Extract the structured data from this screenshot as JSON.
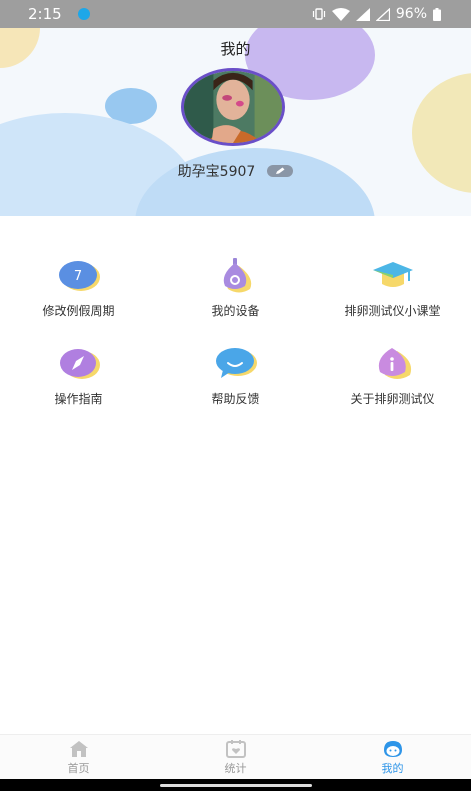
{
  "status_bar": {
    "time": "2:15",
    "battery": "96%"
  },
  "header": {
    "title": "我的",
    "username": "助孕宝5907"
  },
  "menu": [
    {
      "label": "修改例假周期",
      "icon": "calendar-7-icon"
    },
    {
      "label": "我的设备",
      "icon": "device-icon"
    },
    {
      "label": "排卵测试仪小课堂",
      "icon": "graduation-cap-icon"
    },
    {
      "label": "操作指南",
      "icon": "compass-icon"
    },
    {
      "label": "帮助反馈",
      "icon": "chat-bubble-icon"
    },
    {
      "label": "关于排卵测试仪",
      "icon": "info-icon"
    }
  ],
  "icon_glyphs": {
    "calendar": "7"
  },
  "bottom_nav": [
    {
      "label": "首页",
      "icon": "home-icon",
      "active": false
    },
    {
      "label": "统计",
      "icon": "stats-icon",
      "active": false
    },
    {
      "label": "我的",
      "icon": "profile-icon",
      "active": true
    }
  ],
  "colors": {
    "accent": "#2e95e8",
    "status_bar": "#9e9e9e"
  }
}
